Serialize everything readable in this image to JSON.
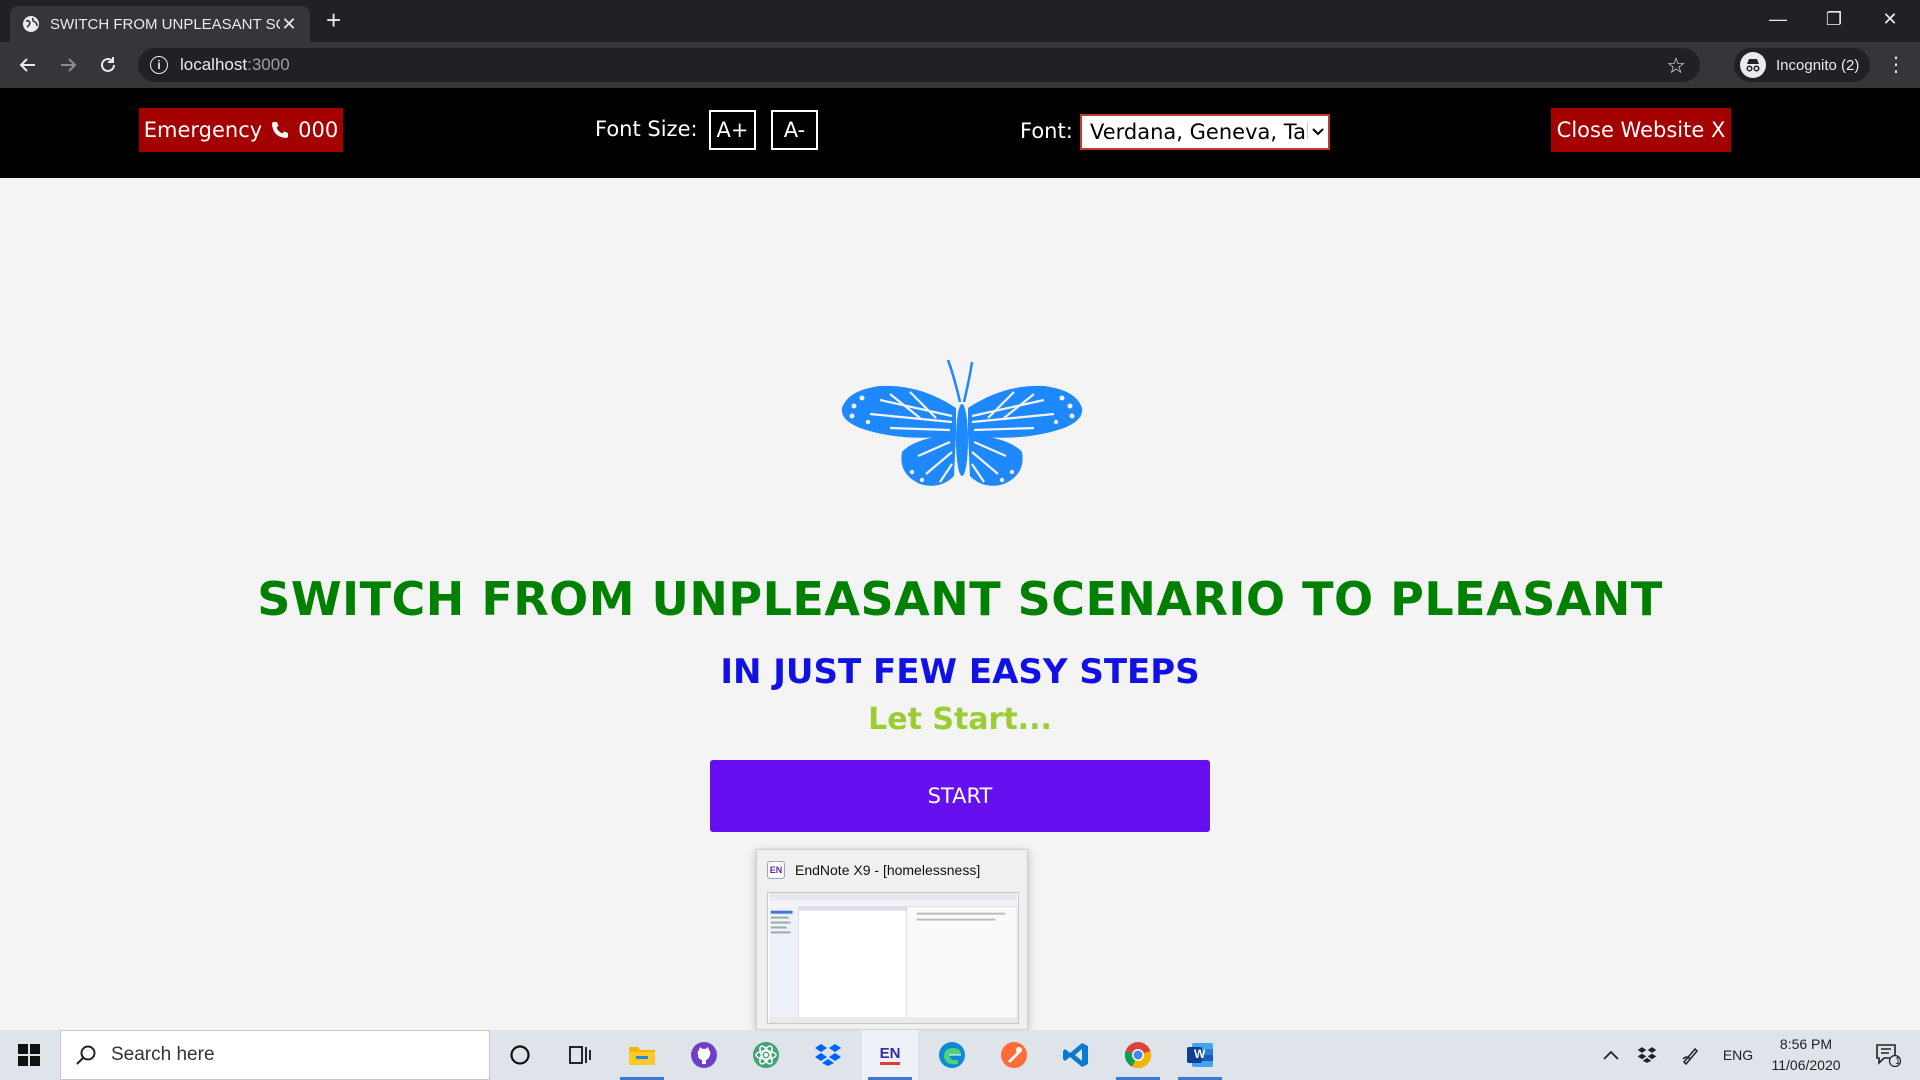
{
  "browser": {
    "tab_title": "SWITCH FROM UNPLEASANT SC",
    "tab_close": "✕",
    "new_tab": "+",
    "url_host": "localhost",
    "url_port": ":3000",
    "incognito_label": "Incognito (2)",
    "window_controls": {
      "minimize": "—",
      "restore": "❐",
      "close": "✕"
    }
  },
  "site_header": {
    "emergency_label": "Emergency",
    "emergency_number": "000",
    "font_size_label": "Font Size:",
    "increase_label": "A+",
    "decrease_label": "A-",
    "font_label": "Font:",
    "font_value": "Verdana, Geneva, Tahoma, sans-serif",
    "close_label": "Close Website X",
    "accent_color": "#a50000"
  },
  "main": {
    "headline": "SWITCH FROM UNPLEASANT SCENARIO TO PLEASANT",
    "subheadline": "IN JUST FEW EASY STEPS",
    "lets_start": "Let Start...",
    "start_button": "START",
    "colors": {
      "headline": "#008000",
      "subheadline": "#1111e6",
      "lets_start": "#9acd32",
      "button": "#6610f2",
      "butterfly": "#1e88ff"
    }
  },
  "taskbar_preview": {
    "app_badge": "EN",
    "title": "EndNote X9 - [homelessness]"
  },
  "taskbar": {
    "search_placeholder": "Search here",
    "apps": [
      "cortana-icon",
      "task-view-icon",
      "file-explorer-icon",
      "github-icon",
      "atom-icon",
      "dropbox-icon",
      "endnote-icon",
      "edge-icon",
      "postman-icon",
      "vscode-icon",
      "chrome-icon",
      "word-icon"
    ],
    "endnote_badge": "EN",
    "word_badge": "W",
    "language": "ENG",
    "time": "8:56 PM",
    "date": "11/06/2020",
    "notification_count": "1"
  }
}
